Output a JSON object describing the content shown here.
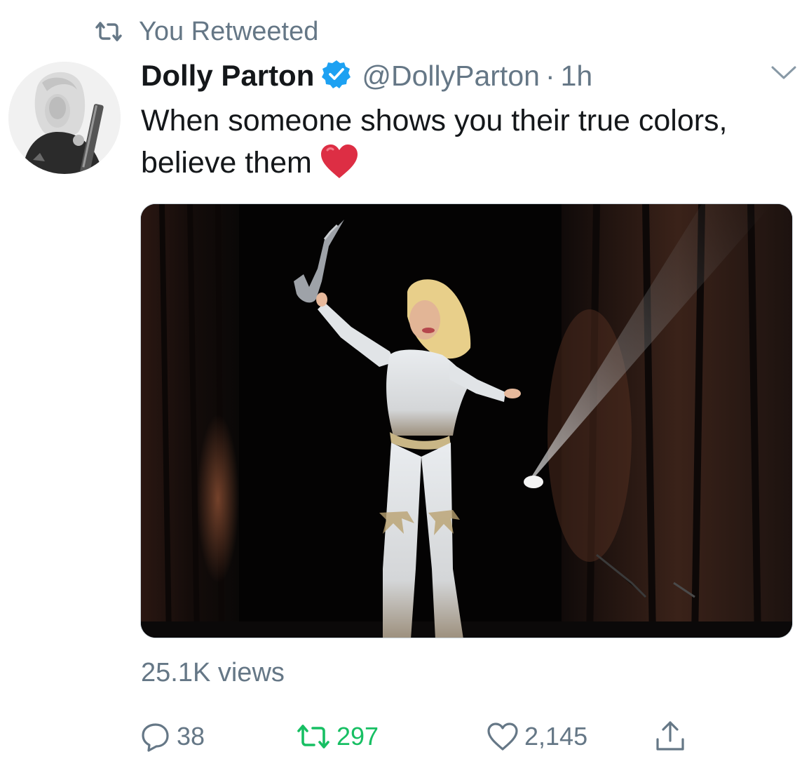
{
  "context": {
    "icon": "retweet-icon",
    "label": "You Retweeted"
  },
  "author": {
    "display_name": "Dolly Parton",
    "verified": true,
    "handle": "@DollyParton",
    "separator": "·",
    "time": "1h",
    "avatar": "avatar-photo"
  },
  "tweet": {
    "text": "When someone shows you their true colors, believe them",
    "emoji": "red-heart-emoji",
    "media": "concert-photo"
  },
  "stats": {
    "views": "25.1K views"
  },
  "actions": {
    "reply_count": "38",
    "retweet_count": "297",
    "like_count": "2,145",
    "retweeted": true
  },
  "colors": {
    "secondary_text": "#657786",
    "retweet_active": "#17bf63",
    "verified_blue": "#1da1f2",
    "text": "#14171a"
  }
}
